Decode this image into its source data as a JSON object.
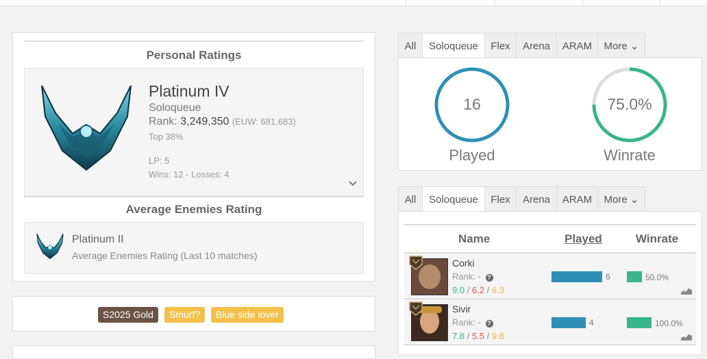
{
  "personal": {
    "title": "Personal Ratings",
    "tier": "Platinum IV",
    "queue": "Soloqueue",
    "rank_label": "Rank:",
    "rank_value": "3,249,350",
    "rank_region": "(EUW: 681,683)",
    "top": "Top 38%",
    "lp": "LP: 5",
    "wins_losses": "Wins: 12 - Losses: 4"
  },
  "enemies": {
    "title": "Average Enemies Rating",
    "tier": "Platinum II",
    "desc": "Average Enemies Rating (Last 10 matches)"
  },
  "badges": [
    {
      "label": "S2025 Gold",
      "color": "#6b5444"
    },
    {
      "label": "Smurf?",
      "color": "#f3c04b"
    },
    {
      "label": "Blue side lover",
      "color": "#f3c04b"
    }
  ],
  "tabs_top": [
    "All",
    "Soloqueue",
    "Flex",
    "Arena",
    "ARAM",
    "More ⌄"
  ],
  "tabs_bottom": [
    "All",
    "Soloqueue",
    "Flex",
    "Arena",
    "ARAM",
    "More ⌄"
  ],
  "stats": {
    "played_value": "16",
    "played_label": "Played",
    "winrate_value": "75.0%",
    "winrate_label": "Winrate",
    "winrate_fraction": 0.75
  },
  "champions": {
    "headers": {
      "name": "Name",
      "played": "Played",
      "winrate": "Winrate"
    },
    "rows": [
      {
        "name": "Corki",
        "rank": "Rank: -",
        "k": "9.0",
        "d": "6.2",
        "a": "6.3",
        "played": "6",
        "played_frac": 0.375,
        "winrate": "50.0%",
        "win_frac": 0.5
      },
      {
        "name": "Sivir",
        "rank": "Rank: -",
        "k": "7.8",
        "d": "5.5",
        "a": "9.8",
        "played": "4",
        "played_frac": 0.25,
        "winrate": "100.0%",
        "win_frac": 1.0
      }
    ]
  },
  "colors": {
    "blue": "#2e8fb5",
    "green": "#3ab48a",
    "red": "#d25b4b",
    "orange": "#f3b54a",
    "ring_grey": "#dddddd"
  }
}
